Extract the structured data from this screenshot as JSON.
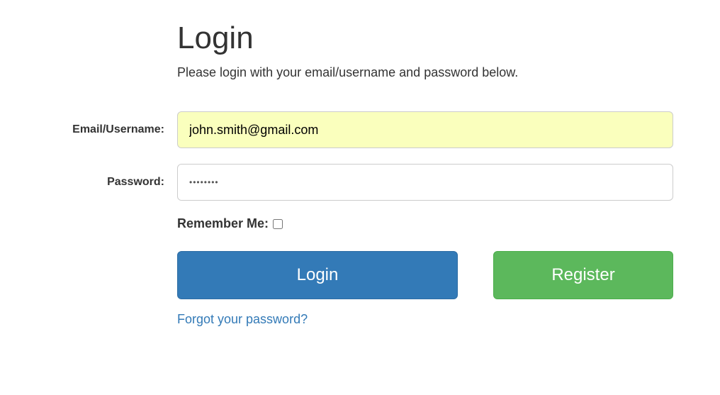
{
  "heading": "Login",
  "subtext": "Please login with your email/username and password below.",
  "labels": {
    "email": "Email/Username:",
    "password": "Password:",
    "remember": "Remember Me:"
  },
  "fields": {
    "email_value": "john.smith@gmail.com",
    "password_value": "••••••••"
  },
  "buttons": {
    "login": "Login",
    "register": "Register"
  },
  "links": {
    "forgot": "Forgot your password?"
  }
}
